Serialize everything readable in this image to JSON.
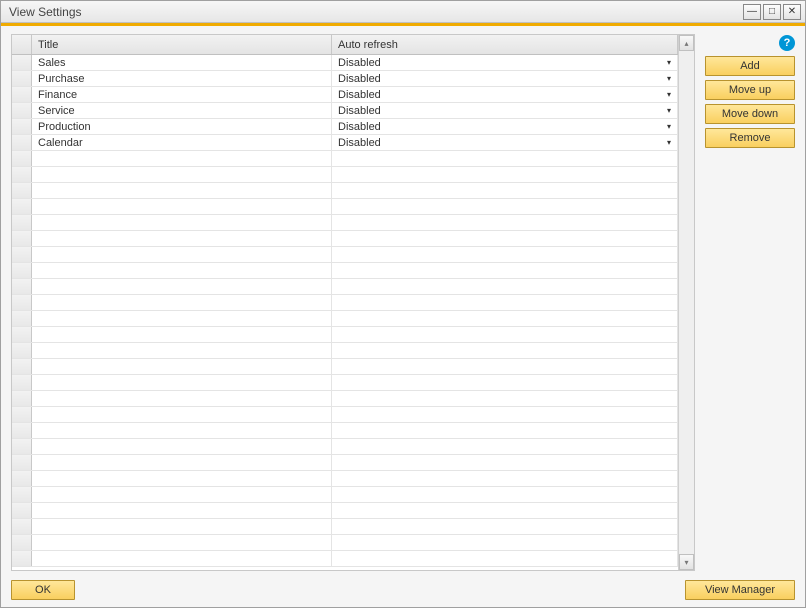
{
  "window": {
    "title": "View Settings"
  },
  "titlebar_controls": {
    "minimize": "—",
    "maximize": "□",
    "close": "✕"
  },
  "help_glyph": "?",
  "table": {
    "headers": {
      "title": "Title",
      "auto_refresh": "Auto refresh"
    },
    "rows": [
      {
        "title": "Sales",
        "auto_refresh": "Disabled"
      },
      {
        "title": "Purchase",
        "auto_refresh": "Disabled"
      },
      {
        "title": "Finance",
        "auto_refresh": "Disabled"
      },
      {
        "title": "Service",
        "auto_refresh": "Disabled"
      },
      {
        "title": "Production",
        "auto_refresh": "Disabled"
      },
      {
        "title": "Calendar",
        "auto_refresh": "Disabled"
      }
    ],
    "empty_row_count": 26
  },
  "buttons": {
    "add": "Add",
    "move_up": "Move up",
    "move_down": "Move down",
    "remove": "Remove",
    "ok": "OK",
    "view_manager": "View Manager"
  },
  "scroll": {
    "up": "▴",
    "down": "▾"
  },
  "dropdown_arrow": "▾"
}
